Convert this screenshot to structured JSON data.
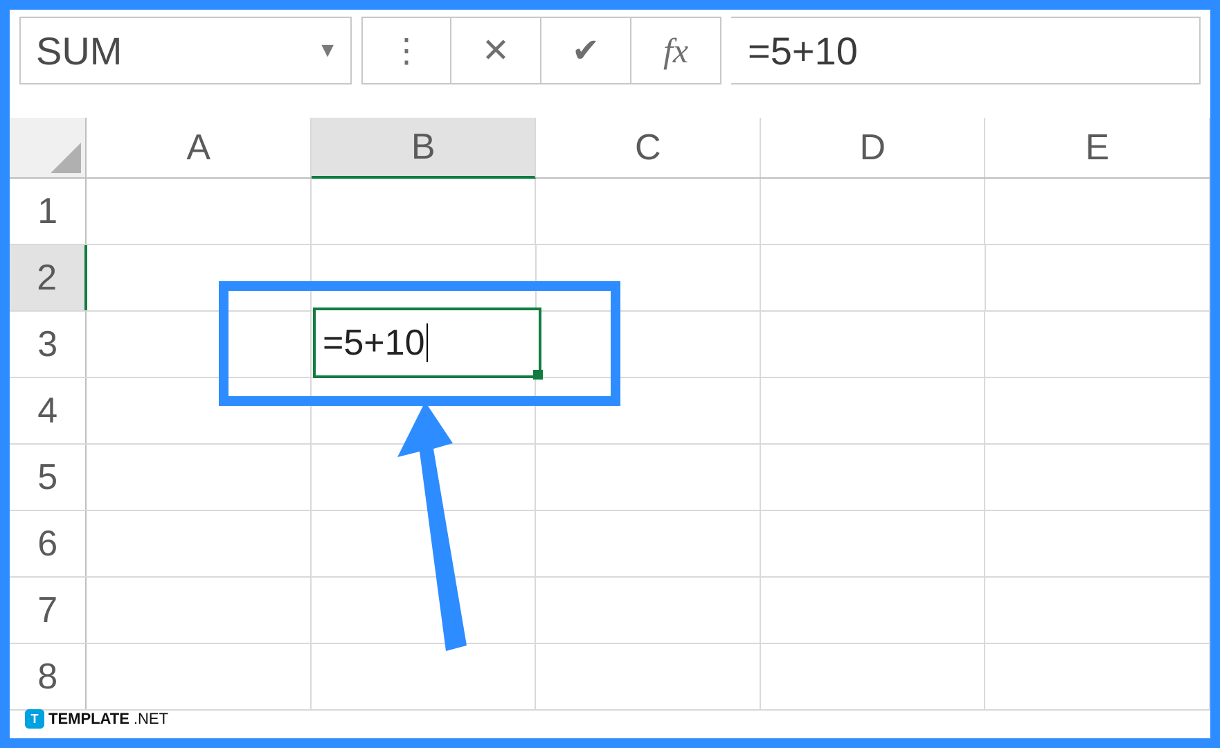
{
  "formulaBar": {
    "nameBox": "SUM",
    "formula": "=5+10"
  },
  "columns": [
    "A",
    "B",
    "C",
    "D",
    "E"
  ],
  "rows": [
    "1",
    "2",
    "3",
    "4",
    "5",
    "6",
    "7",
    "8"
  ],
  "activeCell": {
    "col": "B",
    "row": "2",
    "content": "=5+10"
  },
  "watermark": {
    "icon": "T",
    "brand": "TEMPLATE",
    "suffix": ".NET"
  }
}
